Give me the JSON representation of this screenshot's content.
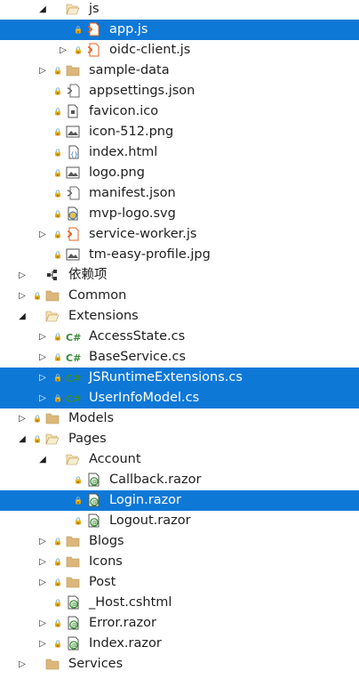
{
  "colors": {
    "selection": "#0e78d7",
    "folder": "#dcb67a",
    "lock": "#2b6fb6",
    "json": "#6b6b6b",
    "html_js": "#e8601c",
    "csharp": "#388a34",
    "razor": "#388a34"
  },
  "tree": [
    {
      "label": "js",
      "icon": "folder-open-icon",
      "depth": 2,
      "expander": "expanded",
      "lock": false,
      "selected": false
    },
    {
      "label": "app.js",
      "icon": "js-file-icon",
      "depth": 3,
      "expander": "none",
      "lock": true,
      "selected": true
    },
    {
      "label": "oidc-client.js",
      "icon": "js-file-icon",
      "depth": 3,
      "expander": "collapsed",
      "lock": true,
      "selected": false
    },
    {
      "label": "sample-data",
      "icon": "folder-icon",
      "depth": 2,
      "expander": "collapsed",
      "lock": true,
      "selected": false
    },
    {
      "label": "appsettings.json",
      "icon": "json-file-icon",
      "depth": 2,
      "expander": "none",
      "lock": true,
      "selected": false
    },
    {
      "label": "favicon.ico",
      "icon": "ico-file-icon",
      "depth": 2,
      "expander": "none",
      "lock": true,
      "selected": false
    },
    {
      "label": "icon-512.png",
      "icon": "image-file-icon",
      "depth": 2,
      "expander": "none",
      "lock": true,
      "selected": false
    },
    {
      "label": "index.html",
      "icon": "html-file-icon",
      "depth": 2,
      "expander": "none",
      "lock": true,
      "selected": false
    },
    {
      "label": "logo.png",
      "icon": "image-file-icon",
      "depth": 2,
      "expander": "none",
      "lock": true,
      "selected": false
    },
    {
      "label": "manifest.json",
      "icon": "json-file-icon",
      "depth": 2,
      "expander": "none",
      "lock": true,
      "selected": false
    },
    {
      "label": "mvp-logo.svg",
      "icon": "svg-file-icon",
      "depth": 2,
      "expander": "none",
      "lock": true,
      "selected": false
    },
    {
      "label": "service-worker.js",
      "icon": "js-file-icon",
      "depth": 2,
      "expander": "collapsed",
      "lock": true,
      "selected": false
    },
    {
      "label": "tm-easy-profile.jpg",
      "icon": "image-file-icon",
      "depth": 2,
      "expander": "none",
      "lock": true,
      "selected": false
    },
    {
      "label": "依赖项",
      "icon": "dependencies-icon",
      "depth": 1,
      "expander": "collapsed",
      "lock": false,
      "selected": false
    },
    {
      "label": "Common",
      "icon": "folder-icon",
      "depth": 1,
      "expander": "collapsed",
      "lock": true,
      "selected": false
    },
    {
      "label": "Extensions",
      "icon": "folder-open-icon",
      "depth": 1,
      "expander": "expanded",
      "lock": false,
      "selected": false
    },
    {
      "label": "AccessState.cs",
      "icon": "csharp-file-icon",
      "depth": 2,
      "expander": "collapsed",
      "lock": true,
      "selected": false
    },
    {
      "label": "BaseService.cs",
      "icon": "csharp-file-icon",
      "depth": 2,
      "expander": "collapsed",
      "lock": true,
      "selected": false
    },
    {
      "label": "JSRuntimeExtensions.cs",
      "icon": "csharp-file-icon",
      "depth": 2,
      "expander": "collapsed",
      "lock": true,
      "selected": true
    },
    {
      "label": "UserInfoModel.cs",
      "icon": "csharp-file-icon",
      "depth": 2,
      "expander": "collapsed",
      "lock": true,
      "selected": true
    },
    {
      "label": "Models",
      "icon": "folder-icon",
      "depth": 1,
      "expander": "collapsed",
      "lock": true,
      "selected": false
    },
    {
      "label": "Pages",
      "icon": "folder-open-icon",
      "depth": 1,
      "expander": "expanded",
      "lock": true,
      "selected": false
    },
    {
      "label": "Account",
      "icon": "folder-open-icon",
      "depth": 2,
      "expander": "expanded",
      "lock": false,
      "selected": false
    },
    {
      "label": "Callback.razor",
      "icon": "razor-file-icon",
      "depth": 3,
      "expander": "none",
      "lock": true,
      "selected": false
    },
    {
      "label": "Login.razor",
      "icon": "razor-file-icon",
      "depth": 3,
      "expander": "none",
      "lock": true,
      "selected": true
    },
    {
      "label": "Logout.razor",
      "icon": "razor-file-icon",
      "depth": 3,
      "expander": "none",
      "lock": true,
      "selected": false
    },
    {
      "label": "Blogs",
      "icon": "folder-icon",
      "depth": 2,
      "expander": "collapsed",
      "lock": true,
      "selected": false
    },
    {
      "label": "Icons",
      "icon": "folder-icon",
      "depth": 2,
      "expander": "collapsed",
      "lock": true,
      "selected": false
    },
    {
      "label": "Post",
      "icon": "folder-icon",
      "depth": 2,
      "expander": "collapsed",
      "lock": true,
      "selected": false
    },
    {
      "label": "_Host.cshtml",
      "icon": "cshtml-file-icon",
      "depth": 2,
      "expander": "none",
      "lock": true,
      "selected": false
    },
    {
      "label": "Error.razor",
      "icon": "razor-file-icon",
      "depth": 2,
      "expander": "collapsed",
      "lock": true,
      "selected": false
    },
    {
      "label": "Index.razor",
      "icon": "razor-file-icon",
      "depth": 2,
      "expander": "collapsed",
      "lock": true,
      "selected": false
    },
    {
      "label": "Services",
      "icon": "folder-icon",
      "depth": 1,
      "expander": "collapsed",
      "lock": false,
      "selected": false
    }
  ]
}
